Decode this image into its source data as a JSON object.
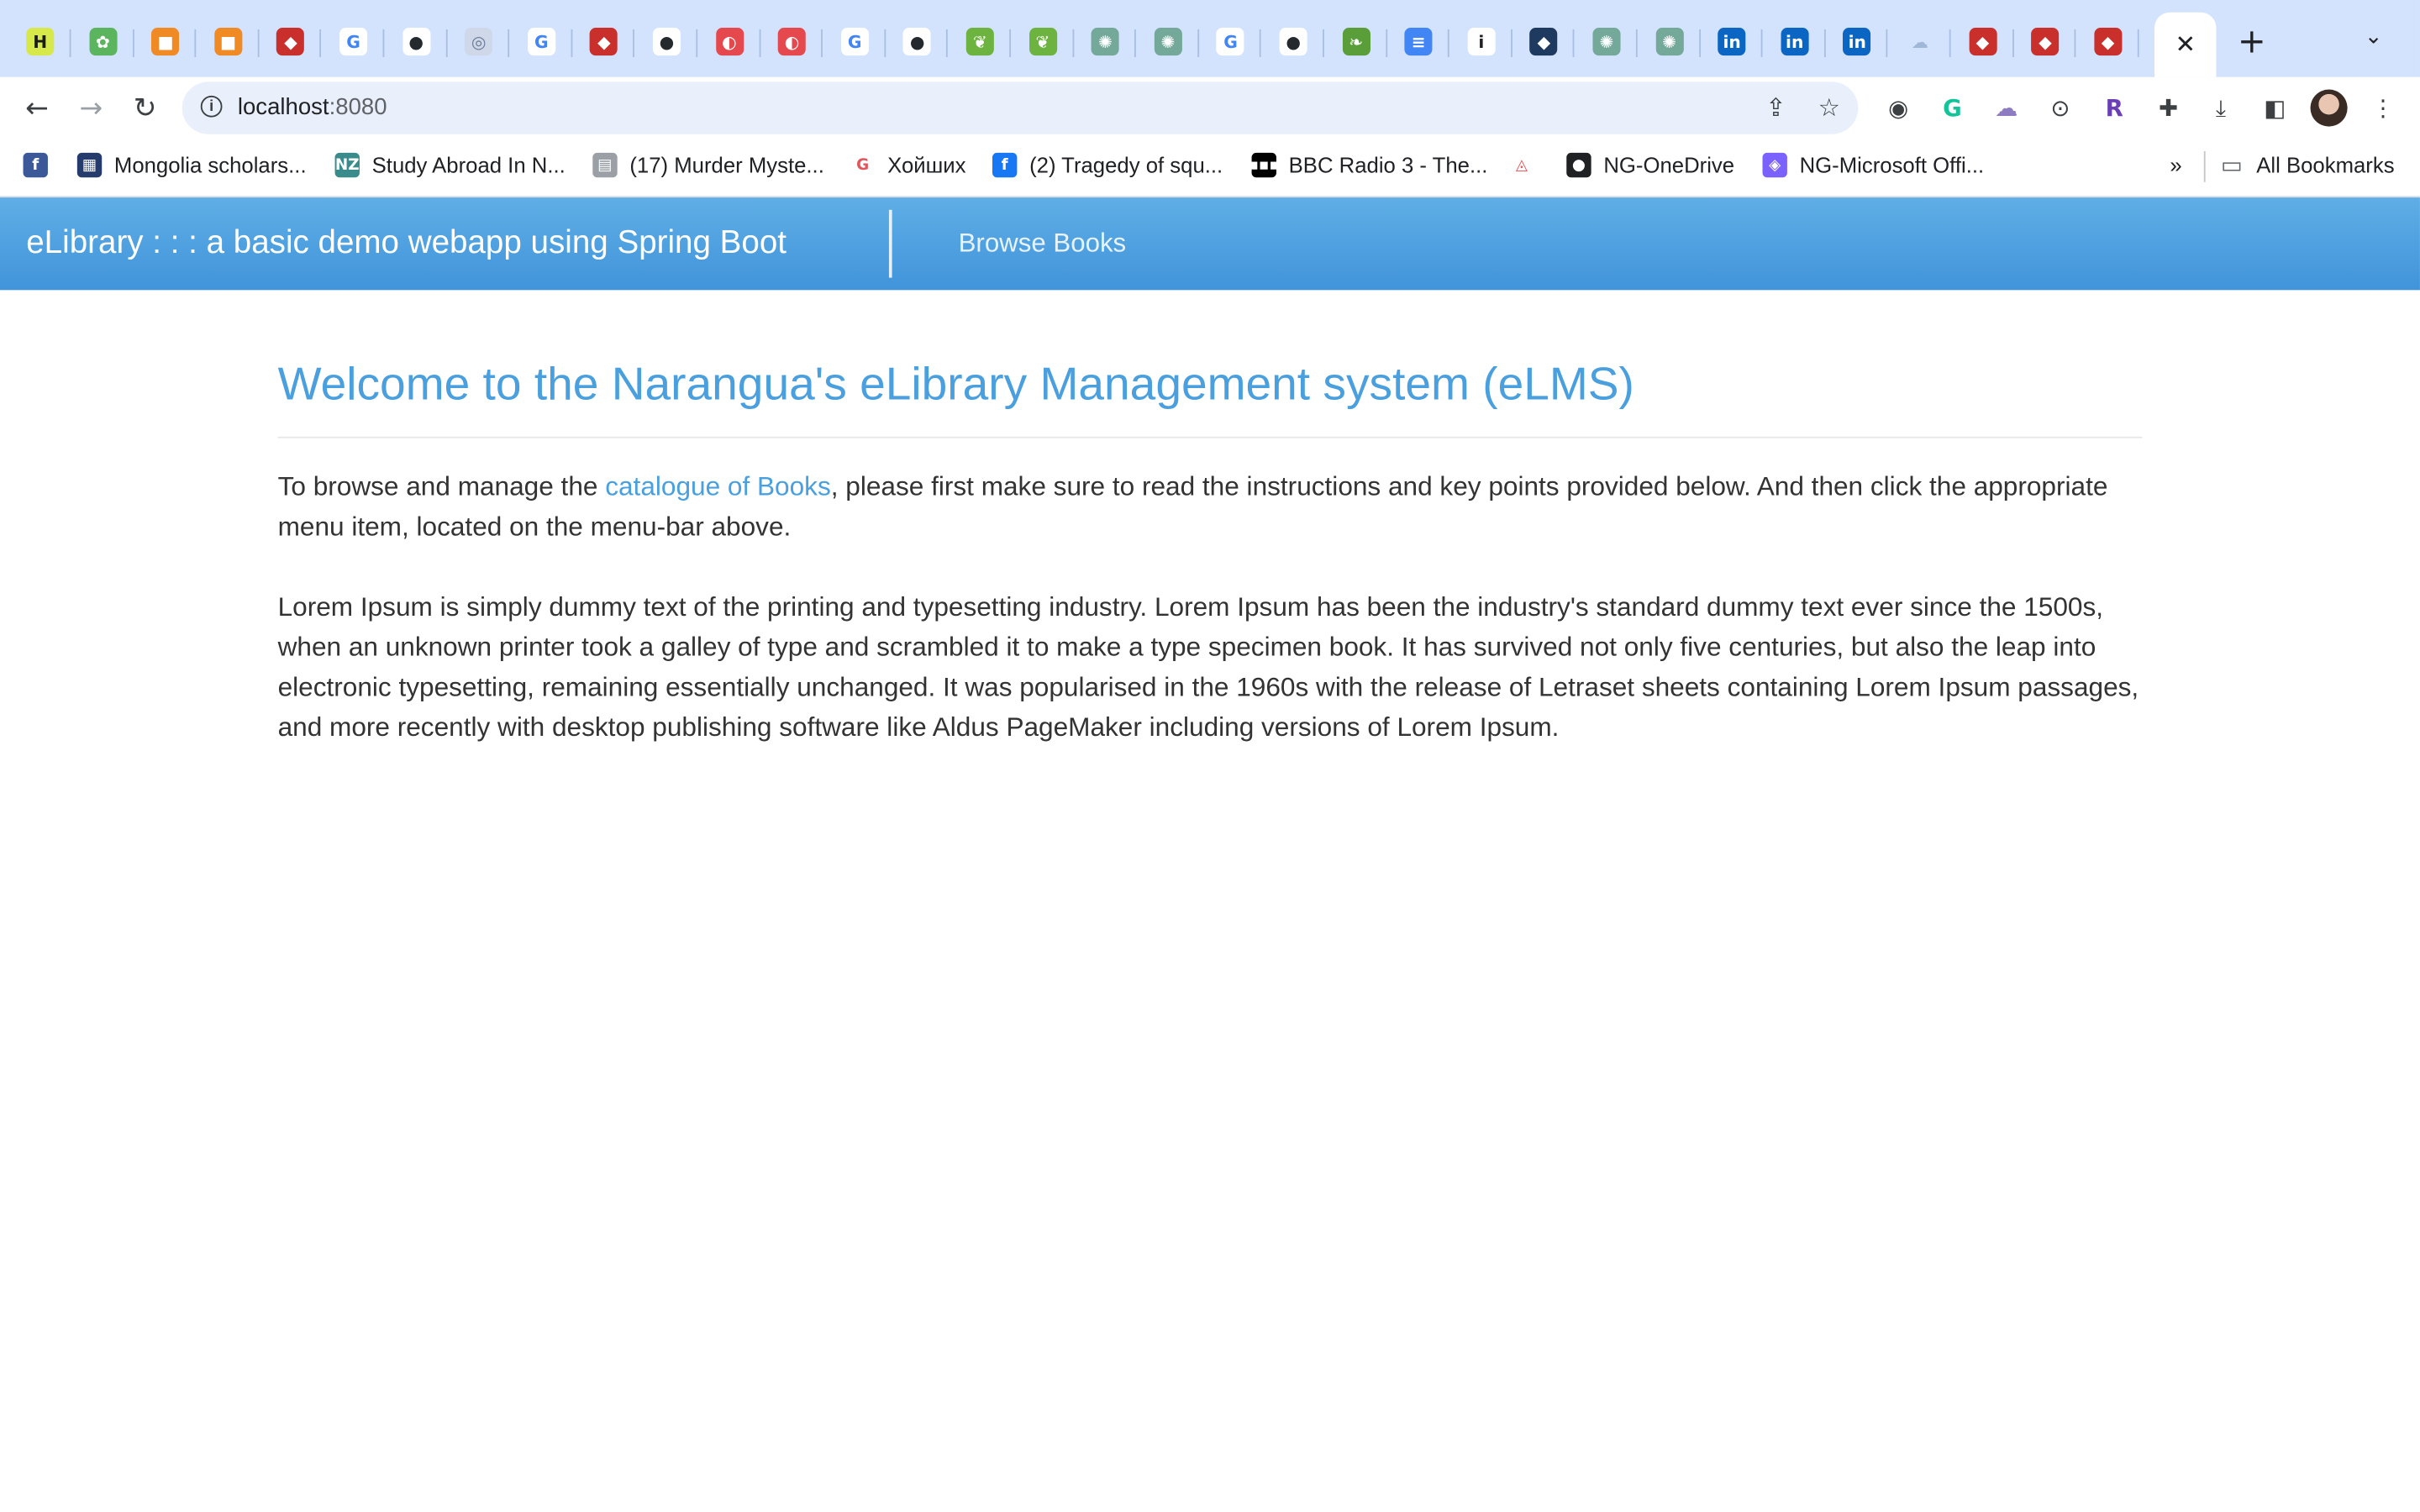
{
  "browser": {
    "tabs": [
      {
        "icon": "h-app-icon",
        "glyph": "H",
        "color": "#d6e84a",
        "fg": "#1a1a1a"
      },
      {
        "icon": "plant-icon",
        "glyph": "✿",
        "color": "#5bb55f",
        "fg": "#ffffff"
      },
      {
        "icon": "orange-box-icon",
        "glyph": "■",
        "color": "#f08a24",
        "fg": "#ffffff"
      },
      {
        "icon": "orange-box-icon",
        "glyph": "■",
        "color": "#f08a24",
        "fg": "#ffffff"
      },
      {
        "icon": "redis-icon",
        "glyph": "◆",
        "color": "#c9302c",
        "fg": "#ffffff"
      },
      {
        "icon": "google-icon",
        "glyph": "G",
        "color": "#ffffff",
        "fg": "#4285f4"
      },
      {
        "icon": "github-icon",
        "glyph": "●",
        "color": "#ffffff",
        "fg": "#24292e"
      },
      {
        "icon": "globe-icon",
        "glyph": "◎",
        "color": "#cfd8e8",
        "fg": "#6b7a99"
      },
      {
        "icon": "google-icon",
        "glyph": "G",
        "color": "#ffffff",
        "fg": "#4285f4"
      },
      {
        "icon": "redis-icon",
        "glyph": "◆",
        "color": "#c9302c",
        "fg": "#ffffff"
      },
      {
        "icon": "github-icon",
        "glyph": "●",
        "color": "#ffffff",
        "fg": "#24292e"
      },
      {
        "icon": "red-circle-icon",
        "glyph": "◐",
        "color": "#e5484d",
        "fg": "#ffffff"
      },
      {
        "icon": "red-circle-icon",
        "glyph": "◐",
        "color": "#e5484d",
        "fg": "#ffffff"
      },
      {
        "icon": "google-icon",
        "glyph": "G",
        "color": "#ffffff",
        "fg": "#4285f4"
      },
      {
        "icon": "github-icon",
        "glyph": "●",
        "color": "#ffffff",
        "fg": "#24292e"
      },
      {
        "icon": "spring-icon",
        "glyph": "❦",
        "color": "#6db33f",
        "fg": "#ffffff"
      },
      {
        "icon": "spring-icon",
        "glyph": "❦",
        "color": "#6db33f",
        "fg": "#ffffff"
      },
      {
        "icon": "openai-icon",
        "glyph": "✺",
        "color": "#74a99a",
        "fg": "#ffffff"
      },
      {
        "icon": "openai-icon",
        "glyph": "✺",
        "color": "#74a99a",
        "fg": "#ffffff"
      },
      {
        "icon": "google-icon",
        "glyph": "G",
        "color": "#ffffff",
        "fg": "#4285f4"
      },
      {
        "icon": "github-icon",
        "glyph": "●",
        "color": "#ffffff",
        "fg": "#24292e"
      },
      {
        "icon": "leaf-icon",
        "glyph": "❧",
        "color": "#5a9e3a",
        "fg": "#ffffff"
      },
      {
        "icon": "docs-icon",
        "glyph": "≡",
        "color": "#4285f4",
        "fg": "#ffffff"
      },
      {
        "icon": "info-icon",
        "glyph": "i",
        "color": "#ffffff",
        "fg": "#202124"
      },
      {
        "icon": "diamond-icon",
        "glyph": "◆",
        "color": "#1f3a5f",
        "fg": "#ffffff"
      },
      {
        "icon": "openai-icon",
        "glyph": "✺",
        "color": "#74a99a",
        "fg": "#ffffff"
      },
      {
        "icon": "openai-icon",
        "glyph": "✺",
        "color": "#74a99a",
        "fg": "#ffffff"
      },
      {
        "icon": "linkedin-icon",
        "glyph": "in",
        "color": "#0a66c2",
        "fg": "#ffffff"
      },
      {
        "icon": "linkedin-icon",
        "glyph": "in",
        "color": "#0a66c2",
        "fg": "#ffffff"
      },
      {
        "icon": "linkedin-icon",
        "glyph": "in",
        "color": "#0a66c2",
        "fg": "#ffffff"
      },
      {
        "icon": "cloud-icon",
        "glyph": "☁",
        "color": "#d3e3fd",
        "fg": "#9fb8d8"
      },
      {
        "icon": "redis-icon",
        "glyph": "◆",
        "color": "#c9302c",
        "fg": "#ffffff"
      },
      {
        "icon": "redis-icon",
        "glyph": "◆",
        "color": "#c9302c",
        "fg": "#ffffff"
      },
      {
        "icon": "redis-icon",
        "glyph": "◆",
        "color": "#c9302c",
        "fg": "#ffffff"
      }
    ],
    "url_host": "localhost",
    "url_port": ":8080",
    "bookmarks": [
      {
        "label": "",
        "icon": "facebook-icon",
        "glyph": "f",
        "color": "#3b5998"
      },
      {
        "label": "Mongolia scholars...",
        "icon": "mongolia-icon",
        "glyph": "▦",
        "color": "#243b6b"
      },
      {
        "label": "Study Abroad In N...",
        "icon": "nz-icon",
        "glyph": "NZ",
        "color": "#3a8c8c"
      },
      {
        "label": "(17) Murder Myste...",
        "icon": "page-icon",
        "glyph": "▤",
        "color": "#9aa0a6"
      },
      {
        "label": "Хойших",
        "icon": "google-icon",
        "glyph": "G",
        "color": "#ffffff"
      },
      {
        "label": "(2) Tragedy of squ...",
        "icon": "facebook-icon",
        "glyph": "f",
        "color": "#1877f2"
      },
      {
        "label": "BBC Radio 3 - The...",
        "icon": "bbc-icon",
        "glyph": "▪▪▪",
        "color": "#000000"
      },
      {
        "label": "",
        "icon": "airbnb-icon",
        "glyph": "◬",
        "color": "#ffffff"
      },
      {
        "label": "NG-OneDrive",
        "icon": "globe-icon",
        "glyph": "●",
        "color": "#202124"
      },
      {
        "label": "NG-Microsoft Offi...",
        "icon": "office-icon",
        "glyph": "◈",
        "color": "#7b61ff"
      }
    ],
    "more_bookmarks": "»",
    "all_bookmarks": "All Bookmarks"
  },
  "app": {
    "brand": "eLibrary : : : a basic demo webapp using Spring Boot",
    "nav_link": "Browse Books",
    "heading": "Welcome to the Narangua's eLibrary Management system (eLMS)",
    "intro_before": "To browse and manage the ",
    "intro_link": "catalogue of Books",
    "intro_after": ", please first make sure to read the instructions and key points provided below. And then click the appropriate menu item, located on the menu-bar above.",
    "lorem": "Lorem Ipsum is simply dummy text of the printing and typesetting industry. Lorem Ipsum has been the industry's standard dummy text ever since the 1500s, when an unknown printer took a galley of type and scrambled it to make a type specimen book. It has survived not only five centuries, but also the leap into electronic typesetting, remaining essentially unchanged. It was popularised in the 1960s with the release of Letraset sheets containing Lorem Ipsum passages, and more recently with desktop publishing software like Aldus PageMaker including versions of Lorem Ipsum."
  },
  "colors": {
    "accent": "#4a9fde",
    "navbar": "#4194da",
    "tabstrip": "#d3e3fd"
  }
}
